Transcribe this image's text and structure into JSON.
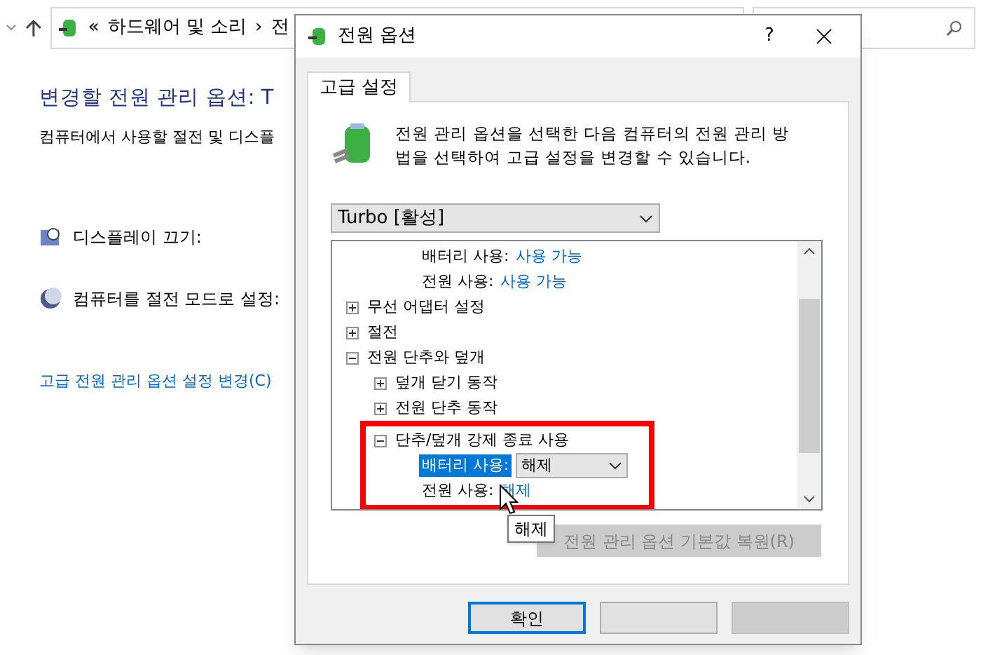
{
  "explorer": {
    "breadcrumb": [
      "«",
      "하드웨어 및 소리",
      "›",
      "전"
    ],
    "heading": "변경할 전원 관리 옵션: T",
    "subtitle": "컴퓨터에서 사용할 절전 및 디스플",
    "settings": [
      {
        "kind": "display",
        "label": "디스플레이 끄기:"
      },
      {
        "kind": "sleep",
        "label": "컴퓨터를 절전 모드로 설정:"
      }
    ],
    "link": "고급 전원 관리 옵션 설정 변경(C)"
  },
  "dialog": {
    "title": "전원 옵션",
    "help": "?",
    "tabs": [
      {
        "label": "고급 설정",
        "selected": true
      }
    ],
    "description": "전원 관리 옵션을 선택한 다음 컴퓨터의 전원 관리 방법을 선택하여 고급 설정을 변경할 수 있습니다.",
    "plan": "Turbo [활성]",
    "scrolled_settings": [
      {
        "label": "배터리 사용:",
        "value": "사용 가능",
        "selected": false
      },
      {
        "label": "전원 사용:",
        "value": "사용 가능",
        "selected": false
      }
    ],
    "tree": [
      {
        "label": "무선 어댑터 설정",
        "expanded": false
      },
      {
        "label": "절전",
        "expanded": false
      },
      {
        "label": "전원 단추와 덮개",
        "expanded": true,
        "children": [
          {
            "label": "덮개 닫기 동작",
            "expanded": false
          },
          {
            "label": "전원 단추 동작",
            "expanded": false
          },
          {
            "label": "단추/덮개 강제 종료 사용",
            "expanded": true,
            "highlighted": true,
            "settings": [
              {
                "label": "배터리 사용:",
                "value": "해제",
                "selected": true
              },
              {
                "label": "전원 사용:",
                "value": "해제",
                "selected": false
              }
            ]
          }
        ]
      }
    ],
    "tooltip": "해제",
    "restore_button": {
      "label": "전원 관리 옵션 기본값 복원(R)",
      "disabled": true
    },
    "ok_button": "확인"
  }
}
